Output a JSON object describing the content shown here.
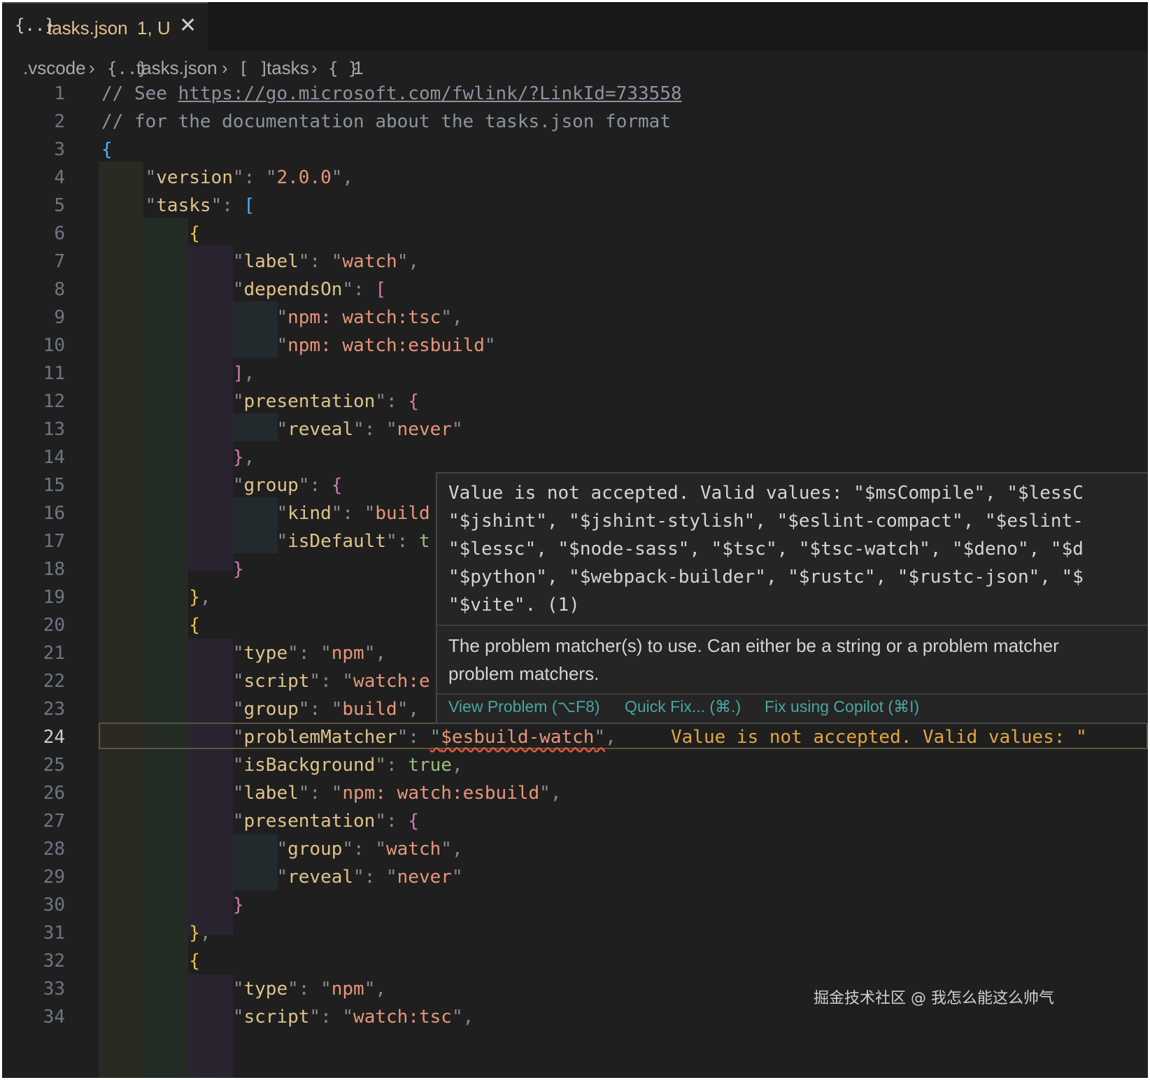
{
  "tab": {
    "icon": "{..}",
    "filename": "tasks.json",
    "status": "1, U",
    "close": "✕"
  },
  "breadcrumb": {
    "folder": ".vscode",
    "file_icon": "{..}",
    "file": "tasks.json",
    "array_icon": "[ ]",
    "array": "tasks",
    "obj_icon": "{ }",
    "obj": "1"
  },
  "editor": {
    "active_line": 24,
    "line_numbers": [
      "1",
      "2",
      "3",
      "4",
      "5",
      "6",
      "7",
      "8",
      "9",
      "10",
      "11",
      "12",
      "13",
      "14",
      "15",
      "16",
      "17",
      "18",
      "19",
      "20",
      "21",
      "22",
      "23",
      "24",
      "25",
      "26",
      "27",
      "28",
      "29",
      "30",
      "31",
      "32",
      "33",
      "34"
    ],
    "inline_error": "Value is not accepted. Valid values: \""
  },
  "hover": {
    "message_lines": [
      "Value is not accepted. Valid values: \"$msCompile\", \"$lessC",
      "\"$jshint\", \"$jshint-stylish\", \"$eslint-compact\", \"$eslint-",
      "\"$lessc\", \"$node-sass\", \"$tsc\", \"$tsc-watch\", \"$deno\", \"$d",
      "\"$python\", \"$webpack-builder\", \"$rustc\", \"$rustc-json\", \"$",
      "\"$vite\". (1)"
    ],
    "description_lines": [
      "The problem matcher(s) to use. Can either be a string or a problem matcher",
      "problem matchers."
    ],
    "actions": {
      "view_problem": "View Problem (⌥F8)",
      "quick_fix": "Quick Fix... (⌘.)",
      "copilot": "Fix using Copilot (⌘I)"
    }
  },
  "watermark": "掘金技术社区 @ 我怎么能这么帅气"
}
